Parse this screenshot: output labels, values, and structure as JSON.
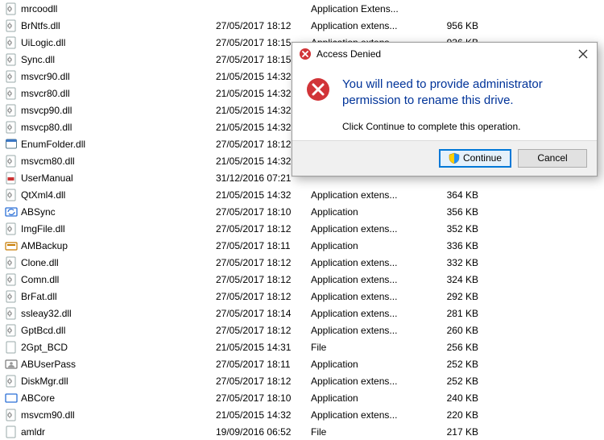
{
  "files": [
    {
      "name": "mrcoodll",
      "icon": "dll",
      "date": "",
      "type": "Application Extens...",
      "size": ""
    },
    {
      "name": "BrNtfs.dll",
      "icon": "dll",
      "date": "27/05/2017 18:12",
      "type": "Application extens...",
      "size": "956 KB"
    },
    {
      "name": "UiLogic.dll",
      "icon": "dll",
      "date": "27/05/2017 18:15",
      "type": "Application extens...",
      "size": "936 KB"
    },
    {
      "name": "Sync.dll",
      "icon": "dll",
      "date": "27/05/2017 18:15",
      "type": "",
      "size": ""
    },
    {
      "name": "msvcr90.dll",
      "icon": "dll",
      "date": "21/05/2015 14:32",
      "type": "",
      "size": ""
    },
    {
      "name": "msvcr80.dll",
      "icon": "dll",
      "date": "21/05/2015 14:32",
      "type": "",
      "size": ""
    },
    {
      "name": "msvcp90.dll",
      "icon": "dll",
      "date": "21/05/2015 14:32",
      "type": "",
      "size": ""
    },
    {
      "name": "msvcp80.dll",
      "icon": "dll",
      "date": "21/05/2015 14:32",
      "type": "",
      "size": ""
    },
    {
      "name": "EnumFolder.dll",
      "icon": "app",
      "date": "27/05/2017 18:12",
      "type": "",
      "size": ""
    },
    {
      "name": "msvcm80.dll",
      "icon": "dll",
      "date": "21/05/2015 14:32",
      "type": "",
      "size": ""
    },
    {
      "name": "UserManual",
      "icon": "pdf",
      "date": "31/12/2016 07:21",
      "type": "",
      "size": ""
    },
    {
      "name": "QtXml4.dll",
      "icon": "dll",
      "date": "21/05/2015 14:32",
      "type": "Application extens...",
      "size": "364 KB"
    },
    {
      "name": "ABSync",
      "icon": "absync",
      "date": "27/05/2017 18:10",
      "type": "Application",
      "size": "356 KB"
    },
    {
      "name": "ImgFile.dll",
      "icon": "dll",
      "date": "27/05/2017 18:12",
      "type": "Application extens...",
      "size": "352 KB"
    },
    {
      "name": "AMBackup",
      "icon": "ambackup",
      "date": "27/05/2017 18:11",
      "type": "Application",
      "size": "336 KB"
    },
    {
      "name": "Clone.dll",
      "icon": "dll",
      "date": "27/05/2017 18:12",
      "type": "Application extens...",
      "size": "332 KB"
    },
    {
      "name": "Comn.dll",
      "icon": "dll",
      "date": "27/05/2017 18:12",
      "type": "Application extens...",
      "size": "324 KB"
    },
    {
      "name": "BrFat.dll",
      "icon": "dll",
      "date": "27/05/2017 18:12",
      "type": "Application extens...",
      "size": "292 KB"
    },
    {
      "name": "ssleay32.dll",
      "icon": "dll",
      "date": "27/05/2017 18:14",
      "type": "Application extens...",
      "size": "281 KB"
    },
    {
      "name": "GptBcd.dll",
      "icon": "dll",
      "date": "27/05/2017 18:12",
      "type": "Application extens...",
      "size": "260 KB"
    },
    {
      "name": "2Gpt_BCD",
      "icon": "file",
      "date": "21/05/2015 14:31",
      "type": "File",
      "size": "256 KB"
    },
    {
      "name": "ABUserPass",
      "icon": "abuserpass",
      "date": "27/05/2017 18:11",
      "type": "Application",
      "size": "252 KB"
    },
    {
      "name": "DiskMgr.dll",
      "icon": "dll",
      "date": "27/05/2017 18:12",
      "type": "Application extens...",
      "size": "252 KB"
    },
    {
      "name": "ABCore",
      "icon": "abcore",
      "date": "27/05/2017 18:10",
      "type": "Application",
      "size": "240 KB"
    },
    {
      "name": "msvcm90.dll",
      "icon": "dll",
      "date": "21/05/2015 14:32",
      "type": "Application extens...",
      "size": "220 KB"
    },
    {
      "name": "amldr",
      "icon": "file",
      "date": "19/09/2016 06:52",
      "type": "File",
      "size": "217 KB"
    }
  ],
  "dialog": {
    "title": "Access Denied",
    "headline": "You will need to provide administrator permission to rename this drive.",
    "subtext": "Click Continue to complete this operation.",
    "continue_label": "Continue",
    "cancel_label": "Cancel"
  }
}
